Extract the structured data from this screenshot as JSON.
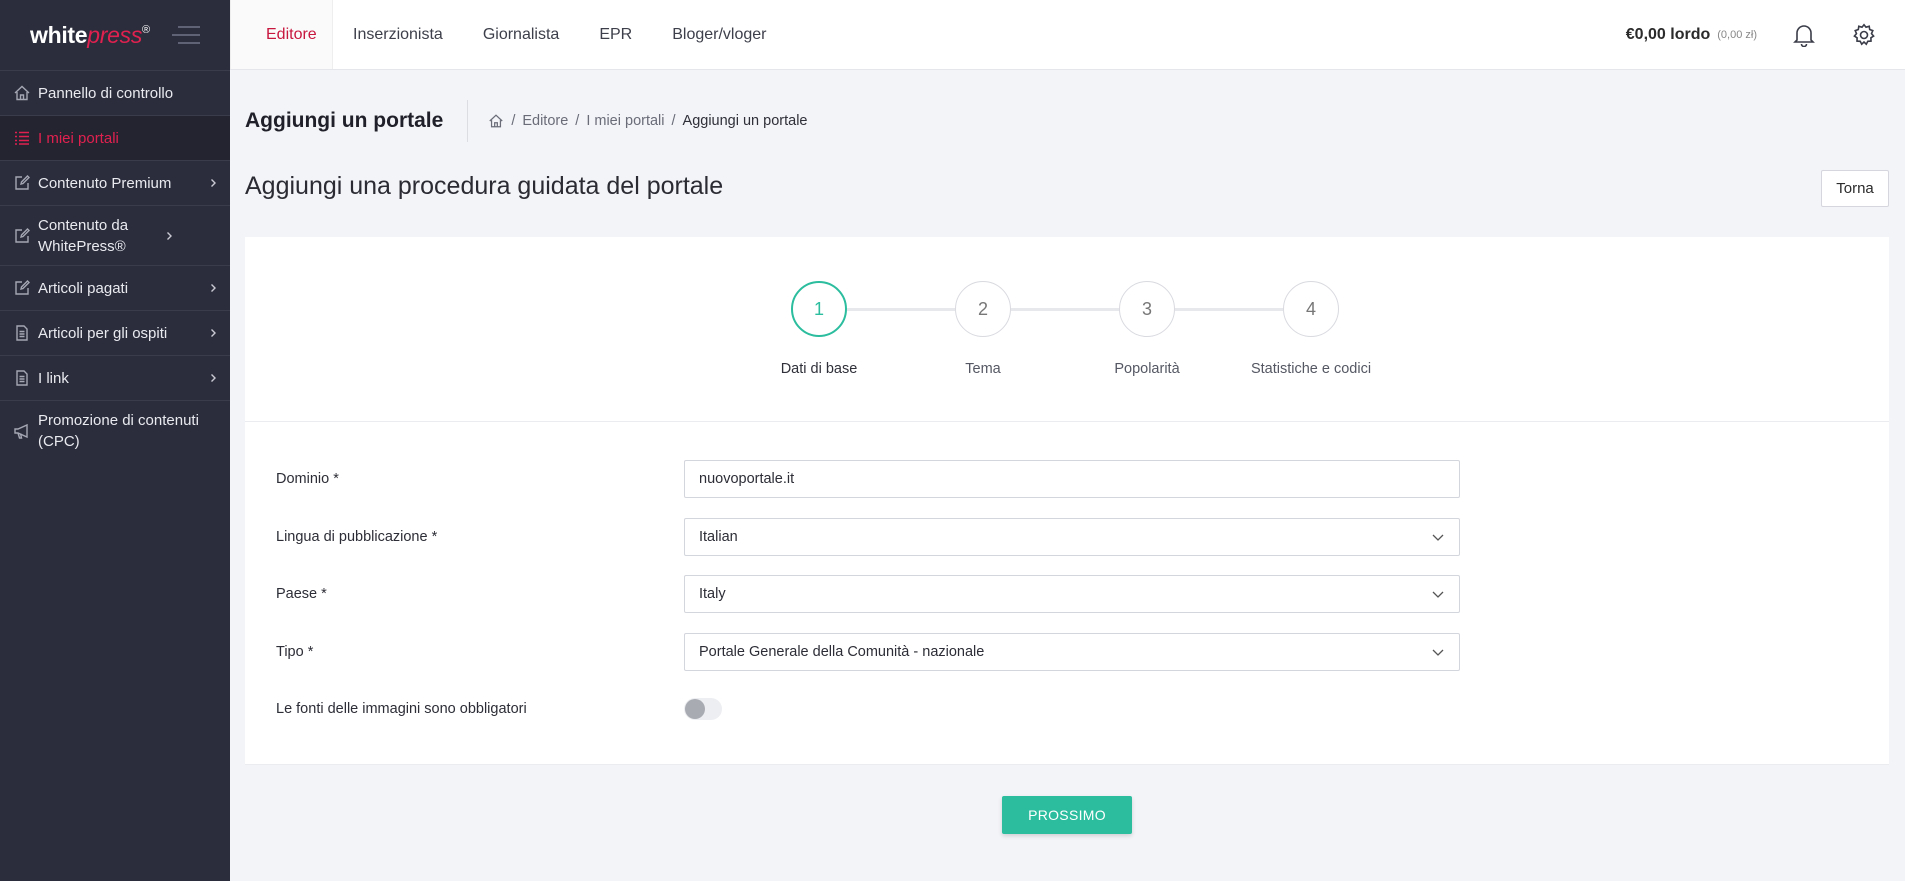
{
  "brand": {
    "name_part1": "white",
    "name_part2": "press",
    "mark": "®"
  },
  "sidebar": {
    "items": [
      {
        "label": "Pannello di controllo",
        "icon": "home-icon",
        "active": false,
        "has_submenu": false
      },
      {
        "label": "I miei portali",
        "icon": "list-icon",
        "active": true,
        "has_submenu": false
      },
      {
        "label": "Contenuto Premium",
        "icon": "edit-icon",
        "active": false,
        "has_submenu": true
      },
      {
        "label": "Contenuto da WhitePress®",
        "icon": "edit-icon",
        "active": false,
        "has_submenu": true
      },
      {
        "label": "Articoli pagati",
        "icon": "edit-icon",
        "active": false,
        "has_submenu": true
      },
      {
        "label": "Articoli per gli ospiti",
        "icon": "document-icon",
        "active": false,
        "has_submenu": true
      },
      {
        "label": "I link",
        "icon": "document-icon",
        "active": false,
        "has_submenu": true
      },
      {
        "label": "Promozione di contenuti (CPC)",
        "icon": "megaphone-icon",
        "active": false,
        "has_submenu": false
      }
    ]
  },
  "topbar": {
    "tabs": [
      {
        "label": "Editore",
        "active": true
      },
      {
        "label": "Inserzionista",
        "active": false
      },
      {
        "label": "Giornalista",
        "active": false
      },
      {
        "label": "EPR",
        "active": false
      },
      {
        "label": "Bloger/vloger",
        "active": false
      }
    ],
    "balance": "€0,00 lordo",
    "balance_sub": "(0,00 zł)"
  },
  "header": {
    "title": "Aggiungi un portale",
    "breadcrumb": [
      "Editore",
      "I miei portali",
      "Aggiungi un portale"
    ]
  },
  "wizard": {
    "title": "Aggiungi una procedura guidata del portale",
    "back_label": "Torna",
    "steps": [
      {
        "number": "1",
        "label": "Dati di base",
        "active": true
      },
      {
        "number": "2",
        "label": "Tema",
        "active": false
      },
      {
        "number": "3",
        "label": "Popolarità",
        "active": false
      },
      {
        "number": "4",
        "label": "Statistiche e codici",
        "active": false
      }
    ]
  },
  "form": {
    "domain": {
      "label": "Dominio *",
      "value": "nuovoportale.it"
    },
    "language": {
      "label": "Lingua di pubblicazione *",
      "value": "Italian"
    },
    "country": {
      "label": "Paese *",
      "value": "Italy"
    },
    "type": {
      "label": "Tipo *",
      "value": "Portale Generale della Comunità - nazionale"
    },
    "image_sources": {
      "label": "Le fonti delle immagini sono obbligatori",
      "enabled": false
    }
  },
  "next_label": "PROSSIMO",
  "colors": {
    "accent": "#2bbd9e",
    "brand_red": "#e0214f",
    "sidebar_bg": "#2b2d3c"
  }
}
